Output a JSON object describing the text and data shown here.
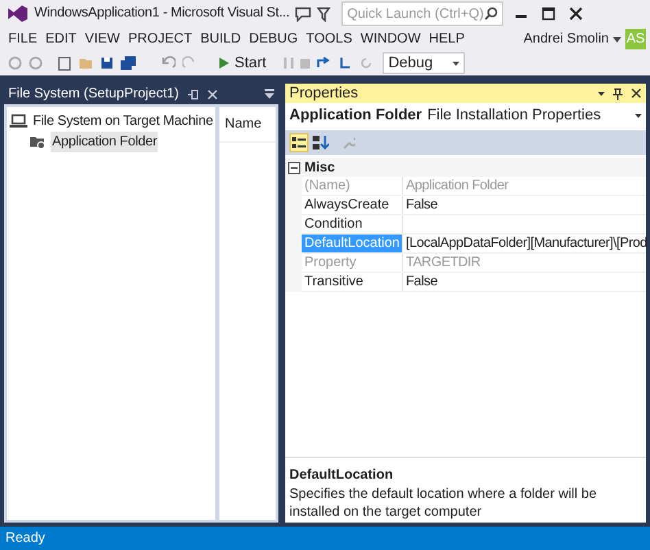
{
  "window": {
    "title": "WindowsApplication1 - Microsoft Visual St...",
    "quick_launch": {
      "placeholder": "Quick Launch (Ctrl+Q)"
    }
  },
  "menu": [
    "FILE",
    "EDIT",
    "VIEW",
    "PROJECT",
    "BUILD",
    "DEBUG",
    "TOOLS",
    "WINDOW",
    "HELP"
  ],
  "account": {
    "name": "Andrei Smolin",
    "initials": "AS"
  },
  "toolbar": {
    "start": "Start",
    "configuration": "Debug"
  },
  "file_system": {
    "title": "File System (SetupProject1)",
    "tree": [
      {
        "label": "File System on Target Machine",
        "selected": false,
        "children": [
          {
            "label": "Application Folder",
            "selected": true
          }
        ]
      }
    ],
    "list_header": "Name"
  },
  "properties": {
    "title": "Properties",
    "object": "Application Folder",
    "object_type": "File Installation Properties",
    "category": "Misc",
    "rows": [
      {
        "name": "(Name)",
        "value": "Application Folder",
        "disabled": true,
        "selected": false
      },
      {
        "name": "AlwaysCreate",
        "value": "False",
        "disabled": false,
        "selected": false
      },
      {
        "name": "Condition",
        "value": "",
        "disabled": false,
        "selected": false
      },
      {
        "name": "DefaultLocation",
        "value": "[LocalAppDataFolder][Manufacturer]\\[Prod",
        "disabled": false,
        "selected": true
      },
      {
        "name": "Property",
        "value": "TARGETDIR",
        "disabled": true,
        "selected": false
      },
      {
        "name": "Transitive",
        "value": "False",
        "disabled": false,
        "selected": false
      }
    ],
    "description": {
      "title": "DefaultLocation",
      "text": "Specifies the default location where a folder will be installed on the target computer"
    }
  },
  "status_bar": "Ready"
}
